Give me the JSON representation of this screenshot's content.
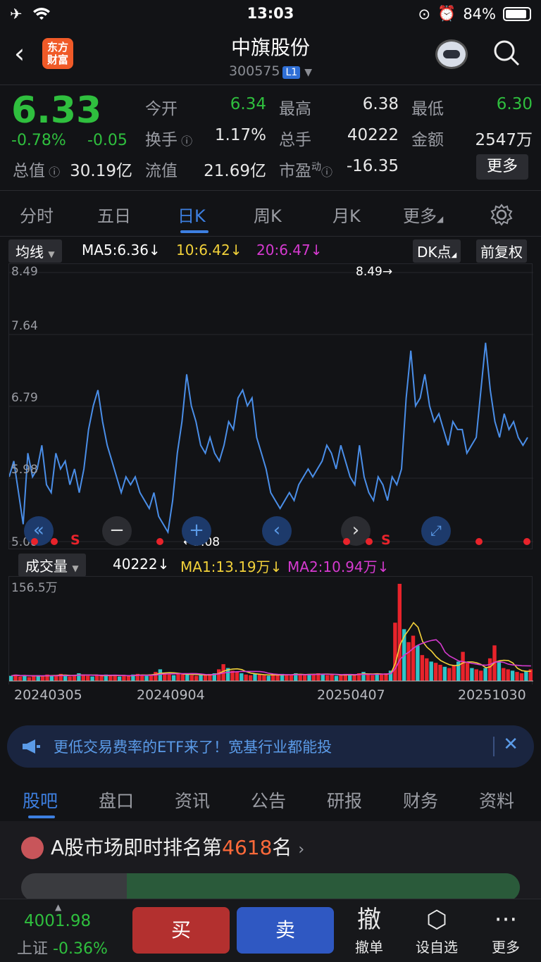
{
  "status": {
    "time": "13:03",
    "battery": "84%"
  },
  "header": {
    "title": "中旗股份",
    "code": "300575",
    "level": "L1",
    "logo": "东方\n财富"
  },
  "quote": {
    "price": "6.33",
    "change_pct": "-0.78%",
    "change": "-0.05",
    "open_label": "今开",
    "open": "6.34",
    "high_label": "最高",
    "high": "6.38",
    "low_label": "最低",
    "low": "6.30",
    "turnover_label": "换手",
    "turnover": "1.17%",
    "volume_label": "总手",
    "volume": "40222",
    "amount_label": "金额",
    "amount": "2547万",
    "mktcap_label": "总值",
    "mktcap": "30.19亿",
    "float_label": "流值",
    "float": "21.69亿",
    "pe_label": "市盈",
    "pe_sup": "动",
    "pe": "-16.35",
    "more": "更多"
  },
  "tabs": [
    "分时",
    "五日",
    "日K",
    "周K",
    "月K",
    "更多"
  ],
  "active_tab": "日K",
  "ma": {
    "selector": "均线",
    "ma5": "MA5:6.36↓",
    "ma10": "10:6.42↓",
    "ma20": "20:6.47↓",
    "dk": "DK点",
    "adj": "前复权"
  },
  "colors": {
    "ma10": "#f2d13a",
    "ma20": "#d63ad0",
    "up": "#e8232b",
    "down": "#2fbf3e",
    "line": "#4a8ee8"
  },
  "chart_data": {
    "type": "line",
    "ylim": [
      5.08,
      8.49
    ],
    "y_ticks": [
      "8.49",
      "7.64",
      "6.79",
      "5.98",
      "5.08"
    ],
    "max_label": "8.49→",
    "min_label": "←5.08",
    "x_labels": [
      "20240305",
      "20240904",
      "20250407",
      "20251030"
    ],
    "values": [
      5.9,
      6.1,
      5.7,
      5.3,
      6.2,
      5.9,
      6.0,
      6.3,
      5.8,
      5.7,
      6.2,
      6.0,
      6.1,
      5.8,
      6.0,
      5.7,
      6.0,
      6.5,
      6.8,
      7.0,
      6.6,
      6.3,
      6.1,
      5.9,
      5.7,
      5.9,
      5.8,
      5.9,
      5.7,
      5.6,
      5.5,
      5.7,
      5.4,
      5.3,
      5.2,
      5.6,
      6.2,
      6.6,
      7.2,
      6.8,
      6.6,
      6.3,
      6.2,
      6.4,
      6.2,
      6.1,
      6.3,
      6.6,
      6.5,
      6.9,
      7.0,
      6.8,
      6.9,
      6.4,
      6.2,
      6.0,
      5.7,
      5.6,
      5.5,
      5.6,
      5.7,
      5.6,
      5.8,
      5.9,
      6.0,
      5.9,
      6.0,
      6.1,
      6.3,
      6.2,
      6.0,
      6.3,
      6.1,
      5.9,
      5.8,
      6.3,
      5.9,
      5.7,
      5.6,
      5.9,
      5.8,
      5.6,
      5.9,
      5.8,
      6.0,
      6.9,
      7.5,
      6.8,
      6.9,
      7.2,
      6.8,
      6.6,
      6.7,
      6.5,
      6.3,
      6.6,
      6.5,
      6.5,
      6.2,
      6.3,
      6.4,
      7.0,
      7.6,
      7.0,
      6.6,
      6.4,
      6.7,
      6.5,
      6.6,
      6.4,
      6.3,
      6.4
    ],
    "volume": {
      "ylabel": "156.5万",
      "selector": "成交量",
      "current": "40222↓",
      "ma1": "MA1:13.19万↓",
      "ma2": "MA2:10.94万↓",
      "values": [
        8,
        10,
        7,
        9,
        6,
        8,
        9,
        7,
        10,
        8,
        9,
        11,
        8,
        7,
        9,
        12,
        10,
        8,
        7,
        9,
        8,
        10,
        9,
        8,
        7,
        9,
        8,
        10,
        11,
        9,
        8,
        10,
        14,
        18,
        12,
        10,
        9,
        11,
        12,
        10,
        9,
        8,
        10,
        9,
        11,
        12,
        18,
        26,
        20,
        16,
        14,
        12,
        10,
        9,
        11,
        10,
        9,
        8,
        10,
        9,
        11,
        10,
        9,
        12,
        10,
        9,
        11,
        10,
        12,
        11,
        9,
        10,
        8,
        9,
        11,
        10,
        9,
        12,
        14,
        10,
        9,
        11,
        10,
        12,
        16,
        90,
        150,
        80,
        60,
        70,
        55,
        40,
        35,
        30,
        28,
        25,
        22,
        20,
        24,
        30,
        45,
        28,
        20,
        18,
        16,
        20,
        35,
        55,
        30,
        20,
        18,
        16,
        14,
        12,
        15,
        18
      ]
    }
  },
  "banner": {
    "text": "更低交易费率的ETF来了！宽基行业都能投"
  },
  "bottom_tabs": [
    "股吧",
    "盘口",
    "资讯",
    "公告",
    "研报",
    "财务",
    "资料"
  ],
  "rank": {
    "prefix": "A股市场即时排名第",
    "num": "4618",
    "suffix": "名"
  },
  "index": {
    "value": "4001.98",
    "name": "上证",
    "change": "-0.36%"
  },
  "actions": {
    "buy": "买",
    "sell": "卖",
    "cancel_glyph": "撤",
    "cancel": "撤单",
    "watch": "设自选",
    "more": "更多"
  }
}
